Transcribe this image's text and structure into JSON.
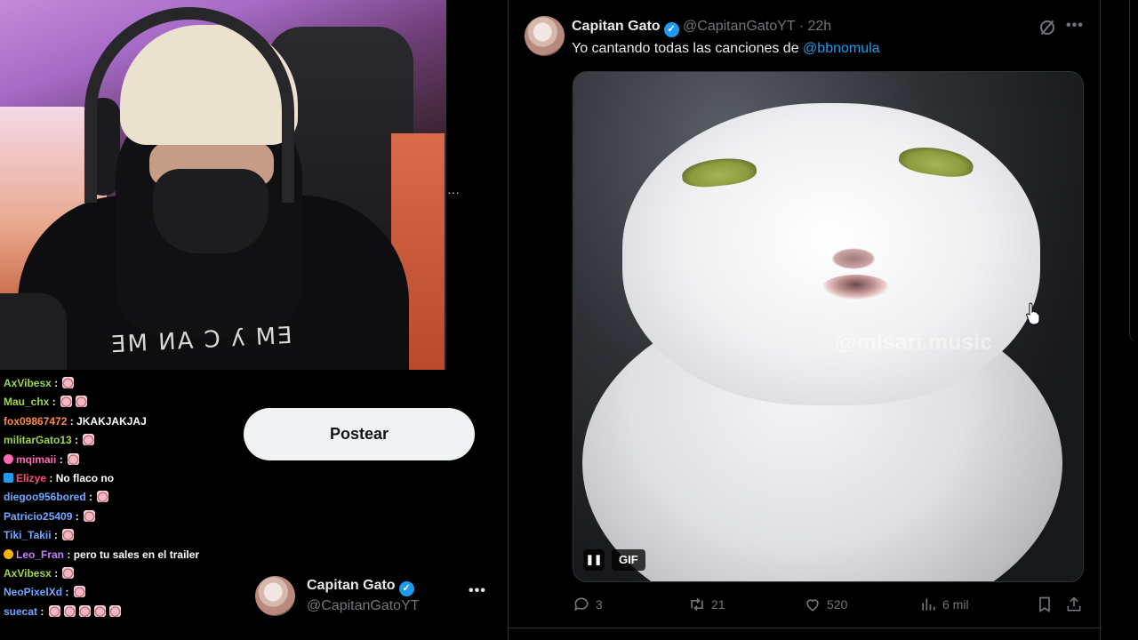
{
  "webcam": {
    "shirt_text": "ƎM ИA Ɔ ʎ MƎ"
  },
  "chat": {
    "lines": [
      {
        "user": "AxVibesx",
        "color": "#9ed64b",
        "msg": "",
        "emotes": 1
      },
      {
        "user": "Mau_chx",
        "color": "#9ed64b",
        "msg": "",
        "emotes": 2
      },
      {
        "user": "fox09867472",
        "color": "#ff8a3d",
        "msg": "JKAKJAKJAJ",
        "emotes": 0
      },
      {
        "user": "militarGato13",
        "color": "#9ed64b",
        "msg": "",
        "emotes": 1
      },
      {
        "user": "mqimaii",
        "color": "#ff69b4",
        "msg": "",
        "emotes": 1
      },
      {
        "user": "Elizye",
        "color": "#ff4d6d",
        "msg": "No flaco no",
        "emotes": 0
      },
      {
        "user": "diegoo956bored",
        "color": "#6fa8ff",
        "msg": "",
        "emotes": 1
      },
      {
        "user": "Patricio25409",
        "color": "#6fa8ff",
        "msg": "",
        "emotes": 1
      },
      {
        "user": "Tiki_Takii",
        "color": "#6fa8ff",
        "msg": "",
        "emotes": 1
      },
      {
        "user": "Leo_Fran",
        "color": "#c77dff",
        "msg": "pero tu sales en el trailer",
        "emotes": 0
      },
      {
        "user": "AxVibesx",
        "color": "#9ed64b",
        "msg": "",
        "emotes": 1
      },
      {
        "user": "NeoPixelXd",
        "color": "#6fa8ff",
        "msg": "",
        "emotes": 1
      },
      {
        "user": "suecat",
        "color": "#6fa8ff",
        "msg": "",
        "emotes": 5
      }
    ]
  },
  "sidebar": {
    "post_label": "Postear",
    "account_name": "Capitan Gato",
    "account_handle": "@CapitanGatoYT"
  },
  "tweet": {
    "author": "Capitan Gato",
    "handle": "@CapitanGatoYT",
    "time": "22h",
    "text": "Yo cantando todas las canciones de ",
    "mention": "@bbnomula",
    "media_watermark": "@misari.music",
    "gif_label": "GIF",
    "replies": "3",
    "reposts": "21",
    "likes": "520",
    "views": "6 mil"
  },
  "icons": [
    "verified-icon",
    "grok-icon",
    "more-icon",
    "pause-icon",
    "reply-icon",
    "repost-icon",
    "like-icon",
    "views-icon",
    "bookmark-icon",
    "share-icon",
    "cursor-icon"
  ],
  "colors": {
    "accent": "#1d9bf0",
    "background": "#000000",
    "muted": "#71767b"
  }
}
